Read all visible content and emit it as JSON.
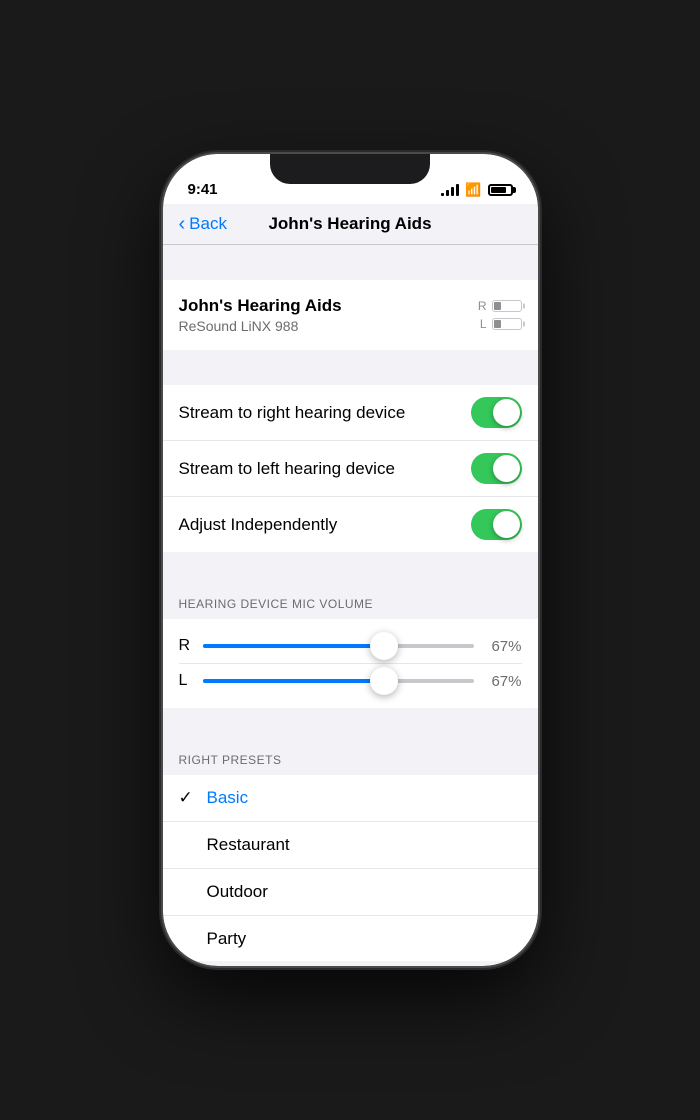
{
  "status_bar": {
    "time": "9:41",
    "signal_bars": [
      3,
      6,
      9,
      12
    ],
    "battery_level": 80
  },
  "nav": {
    "back_label": "Back",
    "title": "John's Hearing Aids"
  },
  "device": {
    "name": "John's Hearing Aids",
    "model": "ReSound LiNX 988",
    "battery_r_label": "R",
    "battery_l_label": "L"
  },
  "toggles": [
    {
      "label": "Stream to right hearing device",
      "on": true
    },
    {
      "label": "Stream to left hearing device",
      "on": true
    },
    {
      "label": "Adjust Independently",
      "on": true
    }
  ],
  "sliders": {
    "section_title": "HEARING DEVICE MIC VOLUME",
    "r_label": "R",
    "r_value": "67%",
    "r_percent": 67,
    "l_label": "L",
    "l_value": "67%",
    "l_percent": 67
  },
  "presets": {
    "section_title": "RIGHT PRESETS",
    "items": [
      {
        "label": "Basic",
        "active": true
      },
      {
        "label": "Restaurant",
        "active": false
      },
      {
        "label": "Outdoor",
        "active": false
      },
      {
        "label": "Party",
        "active": false
      }
    ]
  }
}
